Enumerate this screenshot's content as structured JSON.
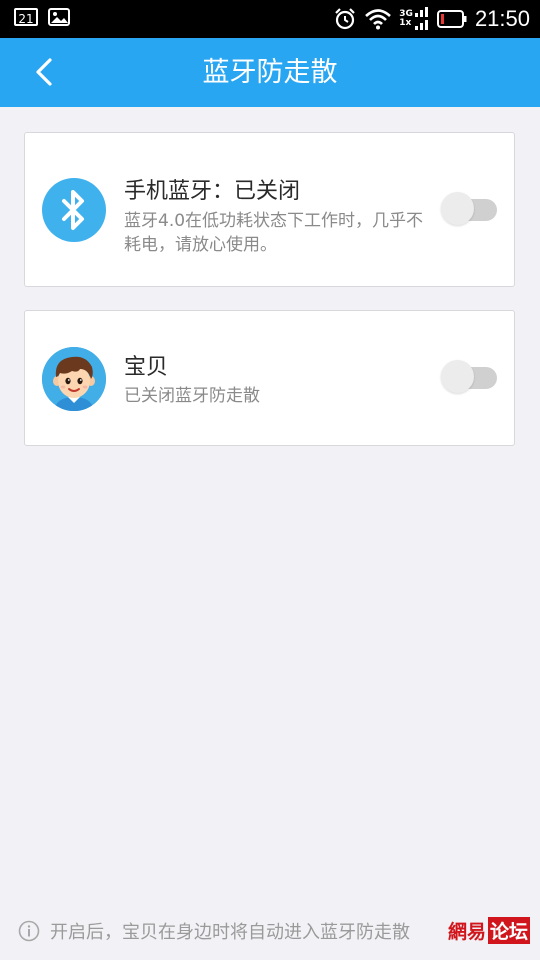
{
  "status_bar": {
    "notification_count": "21",
    "network_top": "3G",
    "network_bottom": "1x",
    "time": "21:50"
  },
  "header": {
    "title": "蓝牙防走散"
  },
  "bluetooth_card": {
    "title": "手机蓝牙：已关闭",
    "description": "蓝牙4.0在低功耗状态下工作时，几乎不耗电，请放心使用。",
    "toggle_state": "off"
  },
  "baby_card": {
    "title": "宝贝",
    "description": "已关闭蓝牙防走散",
    "toggle_state": "off"
  },
  "footer": {
    "tip": "开启后，宝贝在身边时将自动进入蓝牙防走散"
  },
  "watermark": {
    "part1": "網易",
    "part2": "论坛"
  },
  "colors": {
    "accent": "#29a6f2",
    "bluetooth_circle": "#3fb2ee"
  }
}
